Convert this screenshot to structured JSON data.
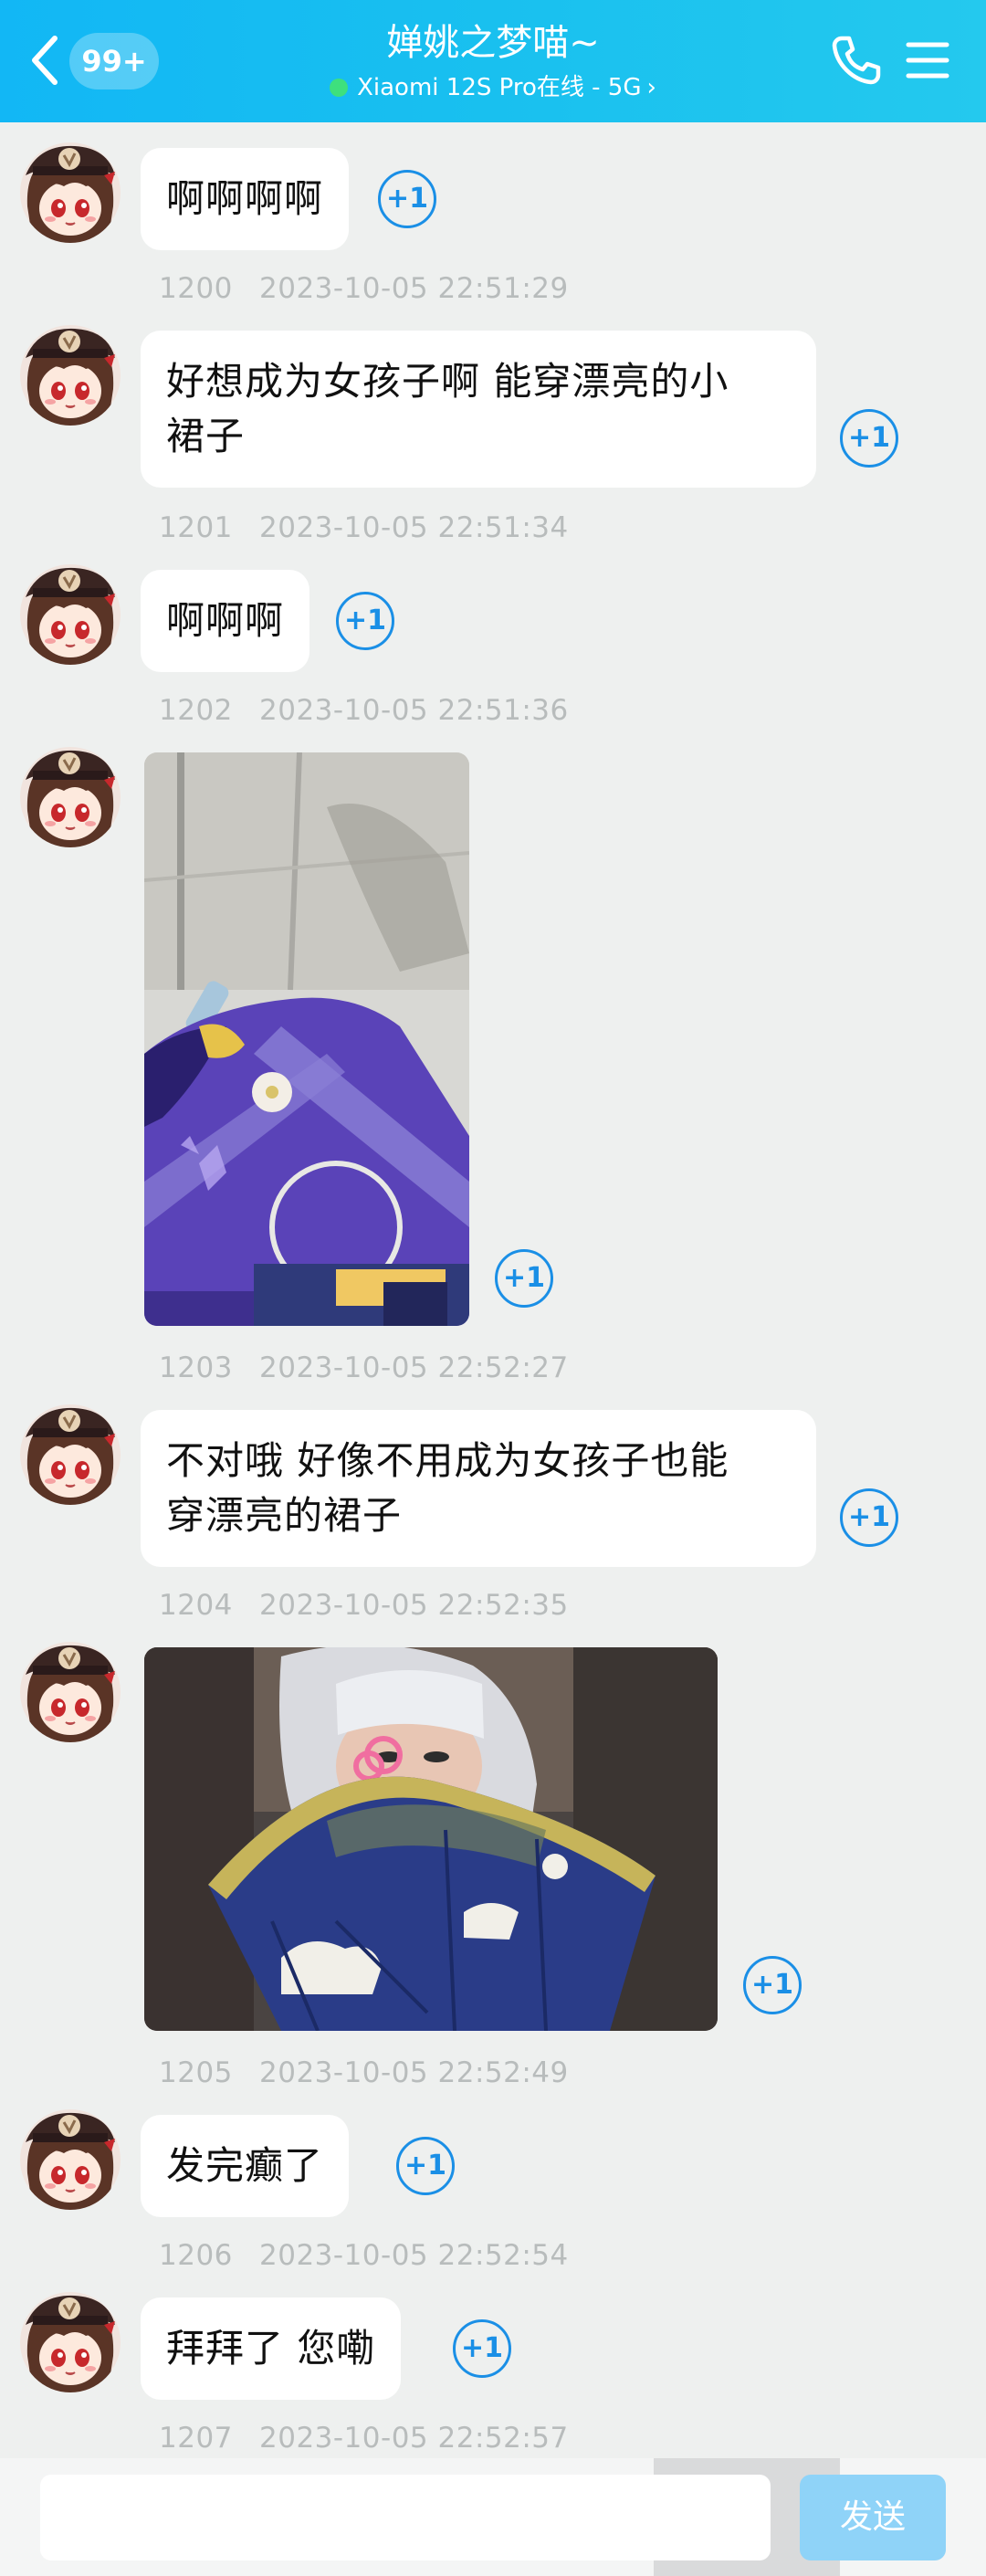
{
  "header": {
    "badge": "99+",
    "title": "婵姚之梦喵~",
    "status": "Xiaomi 12S Pro在线 - 5G",
    "status_chevron": "›"
  },
  "messages": [
    {
      "text": "啊啊啊啊",
      "index": "1200",
      "time": "2023-10-05 22:51:29",
      "plus": "+1"
    },
    {
      "text": "好想成为女孩子啊 能穿漂亮的小\n裙子",
      "index": "1201",
      "time": "2023-10-05 22:51:34",
      "plus": "+1"
    },
    {
      "text": "啊啊啊",
      "index": "1202",
      "time": "2023-10-05 22:51:36",
      "plus": "+1"
    },
    {
      "image": "photo-blue-dress",
      "index": "1203",
      "time": "2023-10-05 22:52:27",
      "plus": "+1"
    },
    {
      "text": "不对哦 好像不用成为女孩子也能\n穿漂亮的裙子",
      "index": "1204",
      "time": "2023-10-05 22:52:35",
      "plus": "+1"
    },
    {
      "image": "photo-cosplay-fan",
      "index": "1205",
      "time": "2023-10-05 22:52:49",
      "plus": "+1"
    },
    {
      "text": "发完癫了",
      "index": "1206",
      "time": "2023-10-05 22:52:54",
      "plus": "+1"
    },
    {
      "text": "拜拜了 您嘞",
      "index": "1207",
      "time": "2023-10-05 22:52:57",
      "plus": "+1"
    }
  ],
  "input": {
    "value": "",
    "send_label": "发送"
  },
  "icons": [
    "back-icon",
    "phone-icon",
    "menu-icon",
    "avatar"
  ],
  "colors": {
    "header": "#12b7f5",
    "accent": "#1a8fe6",
    "online": "#3ee07d",
    "send": "#8fd3f8"
  }
}
